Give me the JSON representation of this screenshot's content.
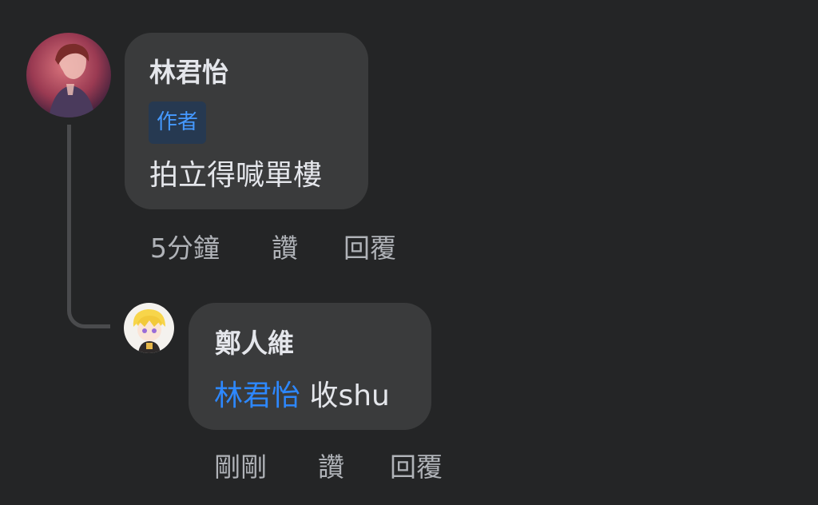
{
  "comment": {
    "author": "林君怡",
    "badge": "作者",
    "text": "拍立得喊單樓",
    "time": "5分鐘",
    "like_label": "讚",
    "reply_label": "回覆",
    "avatar_icon": "user-avatar-icon"
  },
  "reply": {
    "author": "鄭人維",
    "mention": "林君怡",
    "text": " 收shu",
    "time": "剛剛",
    "like_label": "讚",
    "reply_label": "回覆",
    "avatar_icon": "user-avatar-icon"
  },
  "colors": {
    "background": "#242526",
    "bubble": "#3a3b3c",
    "primary_text": "#e4e6eb",
    "secondary_text": "#b0b3b8",
    "mention": "#2d88ff",
    "badge_bg": "#263951",
    "badge_text": "#4599ff"
  }
}
